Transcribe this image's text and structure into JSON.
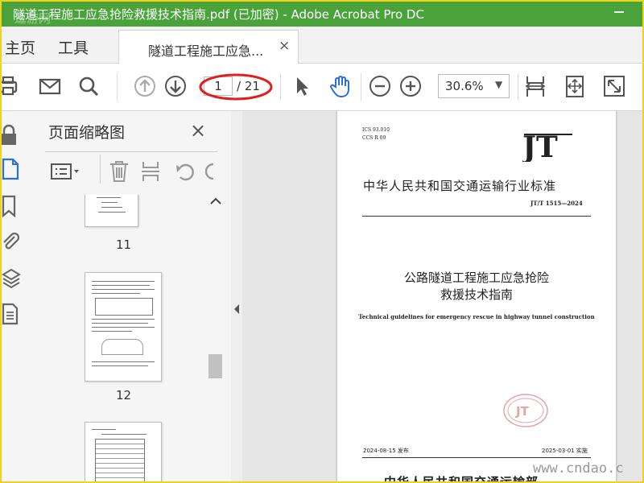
{
  "window": {
    "title": "隧道工程施工应急抢险救援技术指南.pdf  (已加密)  - Adobe Acrobat Pro DC",
    "watermark_top": "逗游网",
    "watermark_bottom": "www.cndao.c"
  },
  "tabs": {
    "home": "主页",
    "tools": "工具",
    "document": "隧道工程施工应急...",
    "close_glyph": "×"
  },
  "toolbar": {
    "current_page": "1",
    "total_pages": "/ 21",
    "zoom": "30.6%",
    "icons": [
      "print-icon",
      "email-icon",
      "search-icon",
      "prev-page-icon",
      "next-page-icon",
      "select-cursor-icon",
      "hand-icon",
      "zoom-out-icon",
      "zoom-in-icon",
      "fit-page-icon",
      "fit-width-icon",
      "fullscreen-icon"
    ]
  },
  "panel": {
    "title": "页面缩略图",
    "close_glyph": "×",
    "thumbnails": [
      {
        "number": "11"
      },
      {
        "number": "12"
      }
    ]
  },
  "document_page": {
    "ics": "ICS 93.010",
    "ccs": "CCS R 09",
    "logo": "JT",
    "industry_title": "中华人民共和国交通运输行业标准",
    "code": "JT/T  1515—2024",
    "main_title_line1": "公路隧道工程施工应急抢险",
    "main_title_line2": "救援技术指南",
    "english_title": "Technical guidelines for emergency rescue in highway tunnel construction",
    "stamp_text": "JT",
    "issue_date": "2024-08-15 发布",
    "impl_date": "2025-03-01 实施",
    "issuer": "中华人民共和国交通运输部"
  },
  "colors": {
    "titlebar": "#4aa33a",
    "frame": "#f2d21a",
    "highlight": "#e02020",
    "accent_blue": "#2a6fdb"
  }
}
